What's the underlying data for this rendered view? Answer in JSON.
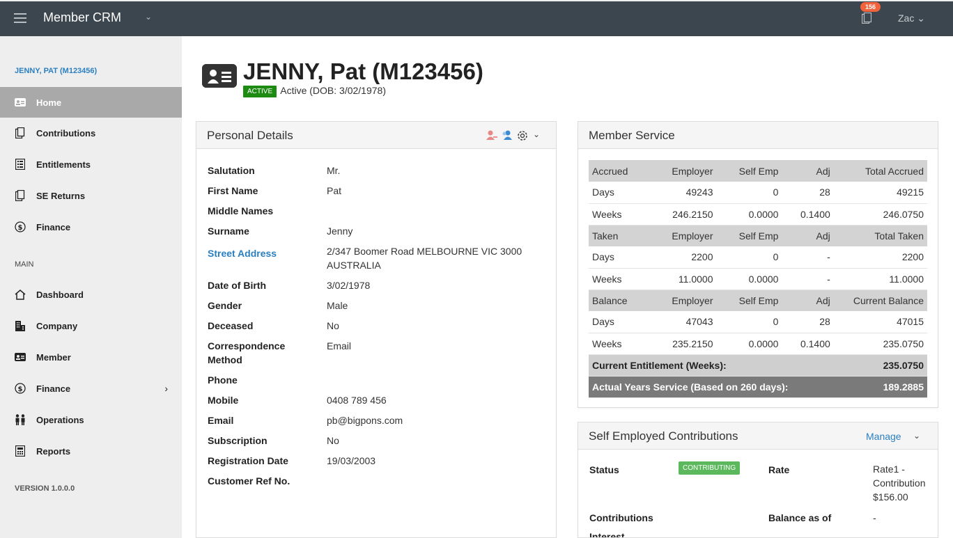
{
  "topbar": {
    "title": "Member CRM",
    "notification_count": "156",
    "user": "Zac ⌄"
  },
  "sidebar": {
    "member_ref": "JENNY, PAT (M123456)",
    "member_items": [
      {
        "label": "Home",
        "icon": "id-card-icon",
        "active": true
      },
      {
        "label": "Contributions",
        "icon": "copy-icon"
      },
      {
        "label": "Entitlements",
        "icon": "list-icon"
      },
      {
        "label": "SE Returns",
        "icon": "copy-icon"
      },
      {
        "label": "Finance",
        "icon": "dollar-icon"
      }
    ],
    "main_label": "MAIN",
    "main_items": [
      {
        "label": "Dashboard",
        "icon": "home-icon"
      },
      {
        "label": "Company",
        "icon": "building-icon"
      },
      {
        "label": "Member",
        "icon": "id-card-icon"
      },
      {
        "label": "Finance",
        "icon": "dollar-icon"
      },
      {
        "label": "Operations",
        "icon": "people-icon"
      },
      {
        "label": "Reports",
        "icon": "calculator-icon"
      }
    ],
    "version": "VERSION 1.0.0.0"
  },
  "header": {
    "title": "JENNY, Pat (M123456)",
    "badge": "ACTIVE",
    "status_text": "Active (DOB: 3/02/1978)"
  },
  "personal_details": {
    "title": "Personal Details",
    "rows": [
      {
        "label": "Salutation",
        "value": "Mr."
      },
      {
        "label": "First Name",
        "value": "Pat"
      },
      {
        "label": "Middle Names",
        "value": ""
      },
      {
        "label": "Surname",
        "value": "Jenny"
      },
      {
        "label": "Street Address",
        "value_line1": "2/347 Boomer Road MELBOURNE VIC 3000",
        "value_line2": "AUSTRALIA"
      },
      {
        "label": "Date of Birth",
        "value": "3/02/1978"
      },
      {
        "label": "Gender",
        "value": "Male"
      },
      {
        "label": "Deceased",
        "value": "No"
      },
      {
        "label_line1": "Correspondence",
        "label_line2": "Method",
        "value": "Email"
      },
      {
        "label": "Phone",
        "value": ""
      },
      {
        "label": "Mobile",
        "value": "0408 789 456"
      },
      {
        "label": "Email",
        "value": "pb@bigpons.com"
      },
      {
        "label": "Subscription",
        "value": "No"
      },
      {
        "label": "Registration Date",
        "value": "19/03/2003"
      },
      {
        "label": "Customer Ref No.",
        "value": ""
      }
    ]
  },
  "member_service": {
    "title": "Member Service",
    "rows": [
      [
        "Accrued",
        "Employer",
        "Self Emp",
        "Adj",
        "Total Accrued"
      ],
      [
        "Days",
        "49243",
        "0",
        "28",
        "49215"
      ],
      [
        "Weeks",
        "246.2150",
        "0.0000",
        "0.1400",
        "246.0750"
      ],
      [
        "Taken",
        "Employer",
        "Self Emp",
        "Adj",
        "Total Taken"
      ],
      [
        "Days",
        "2200",
        "0",
        "-",
        "2200"
      ],
      [
        "Weeks",
        "11.0000",
        "0.0000",
        "-",
        "11.0000"
      ],
      [
        "Balance",
        "Employer",
        "Self Emp",
        "Adj",
        "Current Balance"
      ],
      [
        "Days",
        "47043",
        "0",
        "28",
        "47015"
      ],
      [
        "Weeks",
        "235.2150",
        "0.0000",
        "0.1400",
        "235.0750"
      ]
    ],
    "current_entitlement_label": "Current Entitlement (Weeks):",
    "current_entitlement_value": "235.0750",
    "actual_years_label": "Actual Years Service (Based on 260 days):",
    "actual_years_value": "189.2885"
  },
  "self_employed": {
    "title": "Self Employed Contributions",
    "manage": "Manage",
    "status_label": "Status",
    "status_badge": "CONTRIBUTING",
    "rate_label": "Rate",
    "rate_line1": "Rate1 -",
    "rate_line2": "Contribution",
    "rate_line3": "$156.00",
    "contributions_label": "Contributions",
    "balance_label": "Balance as of",
    "balance_value": "-",
    "interest_label": "Interest"
  },
  "colors": {
    "topbar": "#3c464e",
    "link": "#2a7fc1",
    "active_badge": "#1d8a12",
    "contributing_badge": "#5cb85c",
    "notification_badge": "#f0633c"
  }
}
